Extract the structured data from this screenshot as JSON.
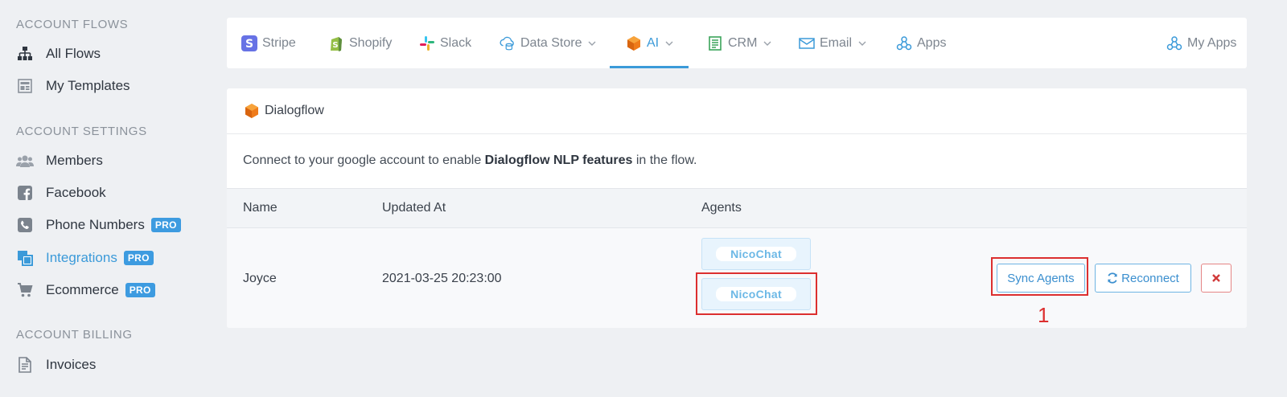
{
  "sidebar": {
    "flows_title": "ACCOUNT FLOWS",
    "all_flows": "All Flows",
    "my_templates": "My Templates",
    "settings_title": "ACCOUNT SETTINGS",
    "members": "Members",
    "facebook": "Facebook",
    "phone_numbers": "Phone Numbers",
    "integrations": "Integrations",
    "ecommerce": "Ecommerce",
    "pro_badge": "PRO",
    "billing_title": "ACCOUNT BILLING",
    "invoices": "Invoices"
  },
  "tabs": {
    "stripe": "Stripe",
    "shopify": "Shopify",
    "slack": "Slack",
    "data_store": "Data Store",
    "ai": "AI",
    "crm": "CRM",
    "email": "Email",
    "apps": "Apps",
    "my_apps": "My Apps"
  },
  "card": {
    "title": "Dialogflow",
    "desc_prefix": "Connect to your google account to enable ",
    "desc_bold": "Dialogflow NLP features",
    "desc_suffix": " in the flow.",
    "col_name": "Name",
    "col_updated": "Updated At",
    "col_agents": "Agents",
    "row_name": "Joyce",
    "row_updated": "2021-03-25 20:23:00",
    "agent_1": "NicoChat",
    "agent_2": "NicoChat",
    "sync_button": "Sync Agents",
    "reconnect_button": "Reconnect",
    "annotation_number": "1"
  },
  "colors": {
    "accent": "#3b9ad9",
    "annotation": "#dc2f2f",
    "pro": "#3d9be0"
  }
}
